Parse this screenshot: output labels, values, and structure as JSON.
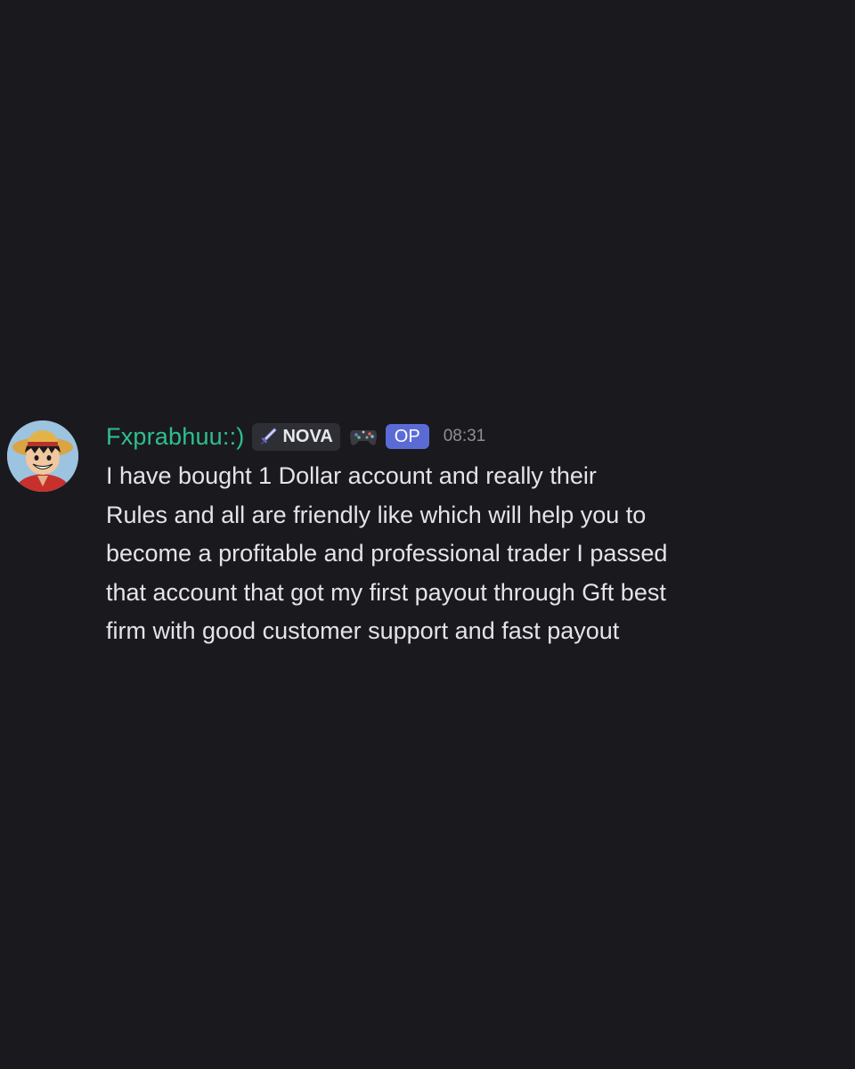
{
  "message": {
    "username": "Fxprabhuu::)",
    "tag": {
      "label": "NOVA",
      "icon": "sword-icon"
    },
    "extra_icon": "gamepad-icon",
    "op_badge": "OP",
    "timestamp": "08:31",
    "avatar_icon": "avatar",
    "content": "I have bought 1 Dollar account and really their\nRules and all are friendly like which will help you to\nbecome a profitable and professional trader I passed\nthat account that got my first payout through Gft best\nfirm with good customer support and fast payout"
  },
  "colors": {
    "background": "#1a1a1e",
    "username": "#2fbf8f",
    "op_badge": "#5b6bd6",
    "text": "#e4e4e8",
    "timestamp": "#8e9099"
  }
}
